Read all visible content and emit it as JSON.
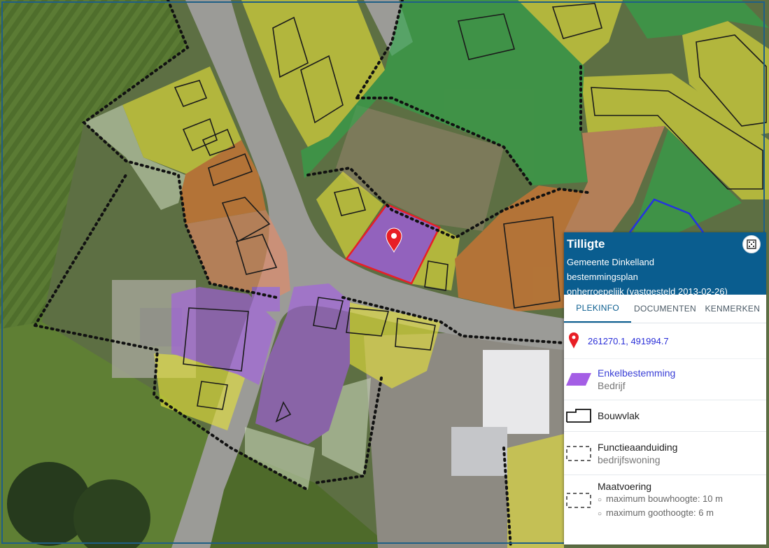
{
  "panel": {
    "title": "Tilligte",
    "municipality": "Gemeente Dinkelland",
    "plan_type": "bestemmingsplan",
    "plan_status": "onherroepelijk (vastgesteld 2013-02-26)",
    "tabs": [
      {
        "label": "PLEKINFO",
        "active": true
      },
      {
        "label": "DOCUMENTEN",
        "active": false
      },
      {
        "label": "KENMERKEN",
        "active": false
      }
    ],
    "coordinates": "261270.1, 491994.7",
    "legend": {
      "enkel": {
        "title": "Enkelbestemming",
        "value": "Bedrijf"
      },
      "bouwvlak": {
        "title": "Bouwvlak"
      },
      "functie": {
        "title": "Functieaanduiding",
        "value": "bedrijfswoning"
      },
      "maat": {
        "title": "Maatvoering",
        "items": [
          "maximum bouwhoogte: 10 m",
          "maximum goothoogte: 6 m"
        ]
      }
    }
  },
  "colors": {
    "header_bg": "#0a5d8f",
    "bedrijf": "#a45ee5",
    "wonen": "#e6e23a",
    "groen": "#2ea84a",
    "gemengd": "#e87730",
    "selected_outline": "#e81e25",
    "pin": "#e81e25"
  },
  "icons": {
    "fullscreen": "fullscreen-icon",
    "pin": "map-pin-icon"
  }
}
